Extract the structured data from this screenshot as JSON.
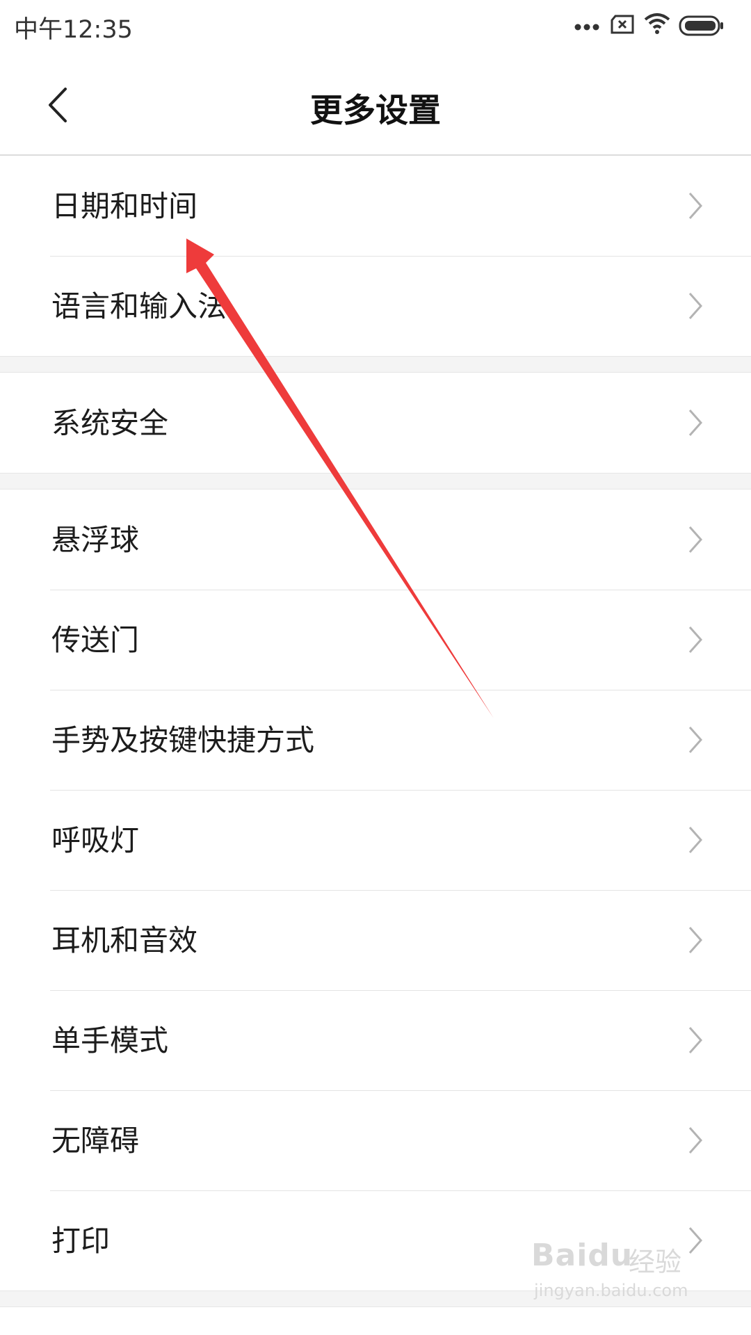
{
  "status_bar": {
    "time": "中午12:35",
    "icons": [
      "more-dots-icon",
      "sim-error-icon",
      "wifi-icon",
      "battery-icon"
    ]
  },
  "header": {
    "title": "更多设置",
    "back_icon": "back-chevron-icon"
  },
  "groups": [
    {
      "items": [
        {
          "label": "日期和时间"
        },
        {
          "label": "语言和输入法"
        }
      ]
    },
    {
      "items": [
        {
          "label": "系统安全"
        }
      ]
    },
    {
      "items": [
        {
          "label": "悬浮球"
        },
        {
          "label": "传送门"
        },
        {
          "label": "手势及按键快捷方式"
        },
        {
          "label": "呼吸灯"
        },
        {
          "label": "耳机和音效"
        },
        {
          "label": "单手模式"
        },
        {
          "label": "无障碍"
        },
        {
          "label": "打印"
        }
      ]
    }
  ],
  "annotation": {
    "color": "#ee3b3b"
  },
  "watermark": {
    "logo": "Baidu",
    "text": "经验",
    "url": "jingyan.baidu.com"
  }
}
